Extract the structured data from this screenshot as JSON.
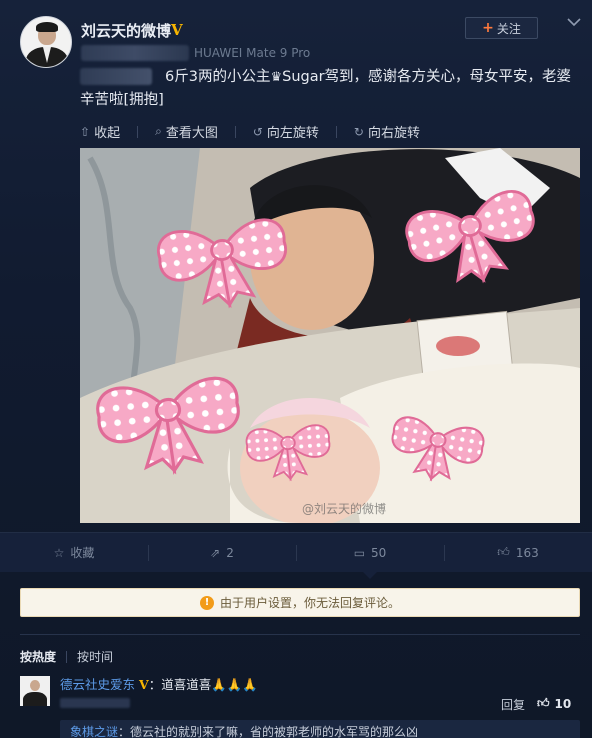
{
  "header": {
    "username": "刘云天的微博",
    "verified_mark": "V",
    "source": "HUAWEI Mate 9 Pro",
    "follow_label": "关注",
    "follow_icon": "plus-icon",
    "more_icon": "chevron-down-icon"
  },
  "post": {
    "text_before": "6斤3两的小公主",
    "crown_icon": "♛",
    "text_after": "Sugar驾到，感谢各方关心，母女平安，老婆辛苦啦[拥抱]",
    "watermark": "@刘云天的微博"
  },
  "tools": {
    "collapse": "收起",
    "view_large": "查看大图",
    "rotate_left": "向左旋转",
    "rotate_right": "向右旋转"
  },
  "actions": {
    "favorite": "收藏",
    "repost_count": "2",
    "comment_count": "50",
    "like_count": "163"
  },
  "notice": {
    "icon": "!",
    "text": "由于用户设置，你无法回复评论。"
  },
  "sort": {
    "by_hot": "按热度",
    "by_time": "按时间"
  },
  "comment": {
    "name": "德云社史爱东",
    "verified_mark": "V",
    "text": "：道喜道喜🙏🙏🙏",
    "reply_label": "回复",
    "like_count": "10"
  },
  "subreply": {
    "name": "象棋之谜",
    "text": "：德云社的就别来了嘛，省的被郭老师的水军骂的那么凶"
  },
  "colors": {
    "background": "#16223a",
    "link_blue": "#5d9be8",
    "verified_gold": "#f7b500",
    "follow_plus": "#ff7a3d",
    "notice_bg": "#f8f4ea"
  }
}
